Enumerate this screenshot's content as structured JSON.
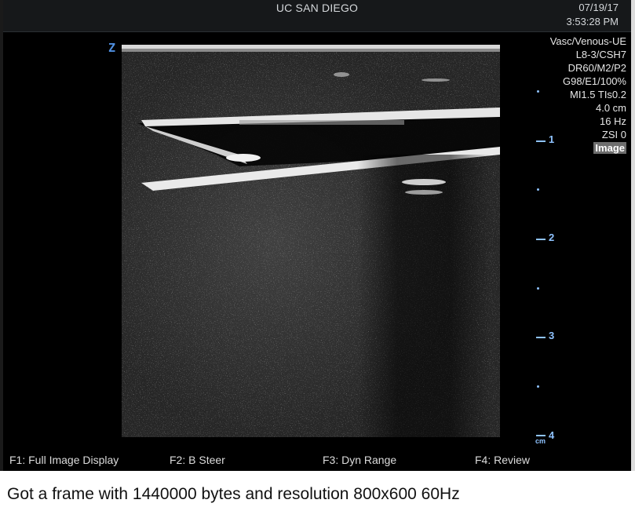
{
  "header": {
    "institution": "UC SAN DIEGO",
    "date": "07/19/17",
    "time": "3:53:28 PM"
  },
  "orientation_marker": "Z",
  "params": {
    "lines": [
      "Vasc/Venous-UE",
      "L8-3/CSH7",
      "DR60/M2/P2",
      "G98/E1/100%",
      "MI1.5  TIs0.2",
      "4.0 cm",
      "16 Hz",
      "ZSI 0"
    ],
    "image_label": "Image"
  },
  "depth_scale": {
    "labels": [
      "1",
      "2",
      "3",
      "4"
    ],
    "unit": "cm"
  },
  "function_keys": [
    {
      "key": "F1:",
      "label": "Full Image Display"
    },
    {
      "key": "F2:",
      "label": "B Steer"
    },
    {
      "key": "F3:",
      "label": "Dyn Range"
    },
    {
      "key": "F4:",
      "label": "Review"
    }
  ],
  "status": "Got a frame with 1440000 bytes and resolution 800x600 60Hz",
  "colors": {
    "scale_accent": "#8fc3ff",
    "orientation_marker": "#4f8fe0",
    "background": "#000000"
  }
}
